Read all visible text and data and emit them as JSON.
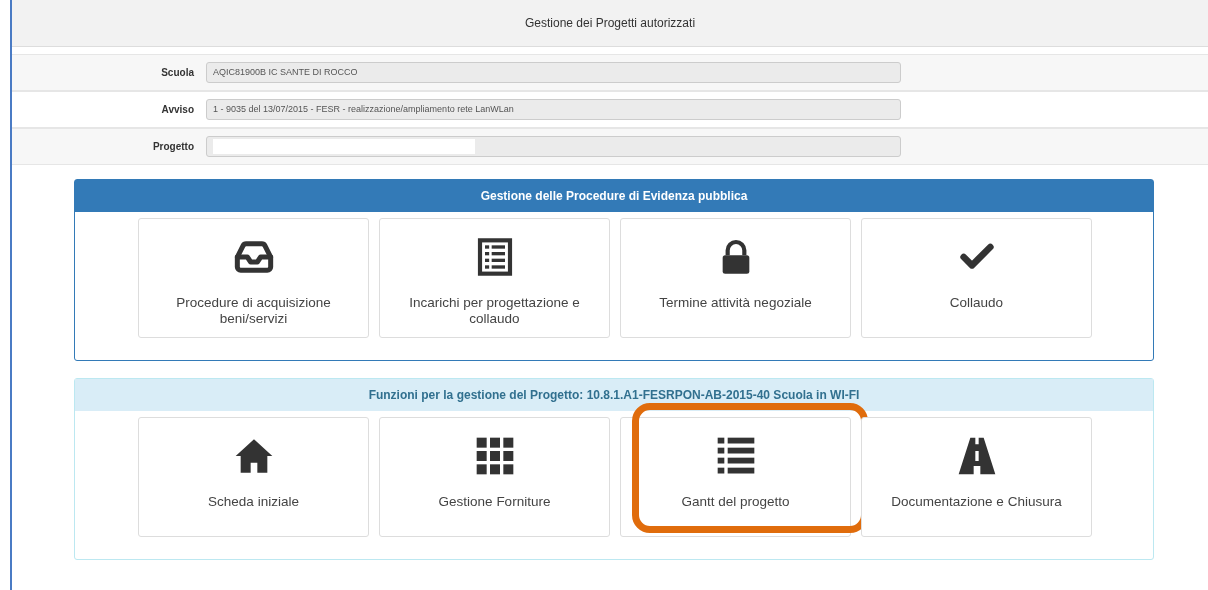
{
  "header": {
    "title": "Gestione dei Progetti autorizzati"
  },
  "fields": [
    {
      "label": "Scuola",
      "value": "AQIC81900B IC  SANTE DI ROCCO",
      "redacted": false
    },
    {
      "label": "Avviso",
      "value": "1 - 9035 del 13/07/2015 - FESR -  realizzazione/ampliamento rete LanWLan",
      "redacted": false
    },
    {
      "label": "Progetto",
      "redacted": true
    }
  ],
  "panels": [
    {
      "title": "Gestione delle Procedure di Evidenza pubblica",
      "kind": "primary",
      "tiles": [
        {
          "kind": "inbox",
          "label": "Procedure di acquisizione beni/servizi",
          "highlighted": false
        },
        {
          "kind": "checklist",
          "label": "Incarichi per progettazione e collaudo",
          "highlighted": false
        },
        {
          "kind": "lock",
          "label": "Termine attività negoziale",
          "highlighted": false
        },
        {
          "kind": "check",
          "label": "Collaudo",
          "highlighted": false
        }
      ]
    },
    {
      "title": "Funzioni per la gestione del Progetto: 10.8.1.A1-FESRPON-AB-2015-40 Scuola in WI-FI",
      "kind": "info",
      "tiles": [
        {
          "kind": "home",
          "label": "Scheda iniziale",
          "highlighted": false
        },
        {
          "kind": "grid",
          "label": "Gestione Forniture",
          "highlighted": false
        },
        {
          "kind": "list",
          "label": "Gantt del progetto",
          "highlighted": true
        },
        {
          "kind": "road",
          "label": "Documentazione e Chiusura",
          "highlighted": false
        }
      ]
    }
  ]
}
